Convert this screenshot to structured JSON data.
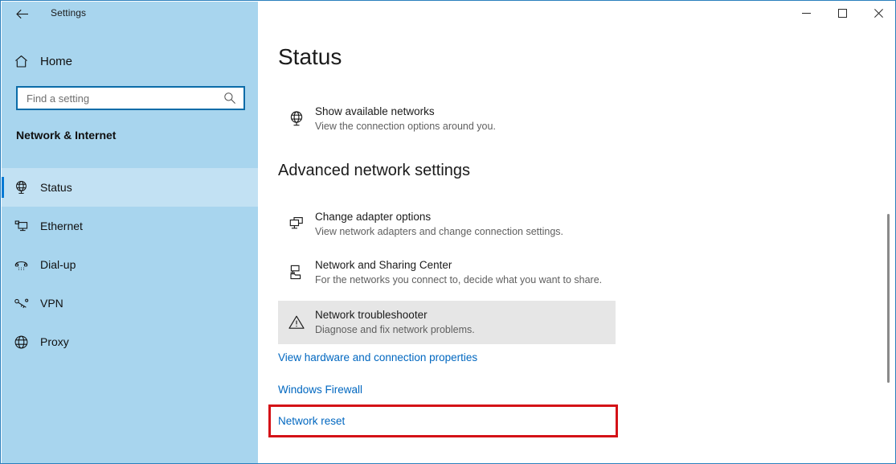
{
  "window": {
    "title": "Settings",
    "back_icon": "back-arrow-icon",
    "controls": {
      "minimize": "—",
      "maximize": "☐",
      "close": "✕"
    }
  },
  "sidebar": {
    "home": {
      "label": "Home",
      "icon": "home-icon"
    },
    "search": {
      "value": "",
      "placeholder": "Find a setting",
      "icon": "search-icon"
    },
    "category_title": "Network & Internet",
    "items": [
      {
        "label": "Status",
        "icon": "globe-monitor-icon",
        "selected": true
      },
      {
        "label": "Ethernet",
        "icon": "ethernet-monitor-icon",
        "selected": false
      },
      {
        "label": "Dial-up",
        "icon": "dialup-phone-icon",
        "selected": false
      },
      {
        "label": "VPN",
        "icon": "vpn-key-icon",
        "selected": false
      },
      {
        "label": "Proxy",
        "icon": "globe-icon",
        "selected": false
      }
    ]
  },
  "main": {
    "page_title": "Status",
    "top_option": {
      "title": "Show available networks",
      "subtitle": "View the connection options around you.",
      "icon": "globe-monitor-icon"
    },
    "section_title": "Advanced network settings",
    "options": [
      {
        "title": "Change adapter options",
        "subtitle": "View network adapters and change connection settings.",
        "icon": "two-monitors-icon",
        "hovered": false
      },
      {
        "title": "Network and Sharing Center",
        "subtitle": "For the networks you connect to, decide what you want to share.",
        "icon": "computer-folder-share-icon",
        "hovered": false
      },
      {
        "title": "Network troubleshooter",
        "subtitle": "Diagnose and fix network problems.",
        "icon": "warning-triangle-icon",
        "hovered": true
      }
    ],
    "links": [
      {
        "label": "View hardware and connection properties",
        "highlighted": false
      },
      {
        "label": "Windows Firewall",
        "highlighted": false
      },
      {
        "label": "Network reset",
        "highlighted": true
      }
    ]
  },
  "colors": {
    "sidebar_bg": "#a8d5ee",
    "accent": "#0078d4",
    "link": "#0067c0",
    "highlight_box": "#d41217",
    "hover_row": "#e6e6e6"
  },
  "scrollbar": {
    "name": "vertical-scrollbar"
  }
}
